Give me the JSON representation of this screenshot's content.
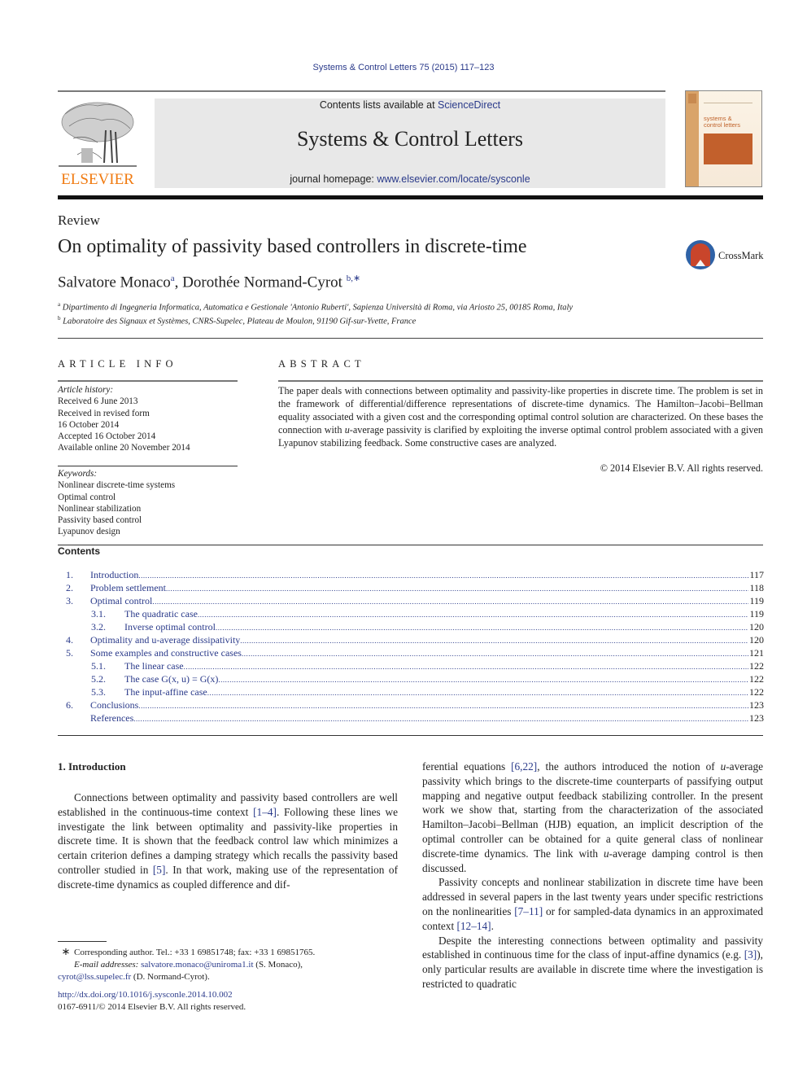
{
  "header": {
    "journal_ref": "Systems & Control Letters 75 (2015) 117–123",
    "contents_prefix": "Contents lists available at ",
    "contents_link": "ScienceDirect",
    "journal_title": "Systems & Control Letters",
    "homepage_prefix": "journal homepage: ",
    "homepage_link": "www.elsevier.com/locate/sysconle",
    "publisher_logo": "ELSEVIER",
    "cover_title_line1": "systems &",
    "cover_title_line2": "control letters"
  },
  "article": {
    "type": "Review",
    "title": "On optimality of passivity based controllers in discrete-time",
    "crossmark_label": "CrossMark",
    "authors": [
      {
        "name": "Salvatore Monaco",
        "sup": "a"
      },
      {
        "name": "Dorothée Normand-Cyrot",
        "sup": "b,∗"
      }
    ],
    "author_separator": ", ",
    "affiliations": [
      {
        "mark": "a",
        "text": "Dipartimento di Ingegneria Informatica, Automatica e Gestionale 'Antonio Ruberti', Sapienza Università di Roma, via Ariosto 25, 00185 Roma, Italy"
      },
      {
        "mark": "b",
        "text": "Laboratoire des Signaux et Systèmes, CNRS-Supelec, Plateau de Moulon, 91190 Gif-sur-Yvette, France"
      }
    ]
  },
  "article_info": {
    "heading": "ARTICLE INFO",
    "history_label": "Article history:",
    "history": [
      "Received 6 June 2013",
      "Received in revised form",
      "16 October 2014",
      "Accepted 16 October 2014",
      "Available online 20 November 2014"
    ],
    "keywords_label": "Keywords:",
    "keywords": [
      "Nonlinear discrete-time systems",
      "Optimal control",
      "Nonlinear stabilization",
      "Passivity based control",
      "Lyapunov design"
    ]
  },
  "abstract": {
    "heading": "ABSTRACT",
    "text_before_u": "The paper deals with connections between optimality and passivity-like properties in discrete time. The problem is set in the framework of differential/difference representations of discrete-time dynamics. The Hamilton–Jacobi–Bellman equality associated with a given cost and the corresponding optimal control solution are characterized. On these bases the connection with ",
    "u": "u",
    "text_after_u": "-average passivity is clarified by exploiting the inverse optimal control problem associated with a given Lyapunov stabilizing feedback. Some constructive cases are analyzed.",
    "copyright": "© 2014 Elsevier B.V. All rights reserved."
  },
  "contents": {
    "heading": "Contents",
    "entries": [
      {
        "num": "1.",
        "title": "Introduction",
        "page": "117",
        "sub": false
      },
      {
        "num": "2.",
        "title": "Problem settlement",
        "page": "118",
        "sub": false
      },
      {
        "num": "3.",
        "title": "Optimal control ",
        "page": "119",
        "sub": false
      },
      {
        "num": "3.1.",
        "title": "The quadratic case ",
        "page": "119",
        "sub": true
      },
      {
        "num": "3.2.",
        "title": "Inverse optimal control ",
        "page": "120",
        "sub": true
      },
      {
        "num": "4.",
        "title": "Optimality and u-average dissipativity ",
        "page": "120",
        "sub": false
      },
      {
        "num": "5.",
        "title": "Some examples and constructive cases",
        "page": "121",
        "sub": false
      },
      {
        "num": "5.1.",
        "title": "The linear case",
        "page": "122",
        "sub": true
      },
      {
        "num": "5.2.",
        "title": "The case G(x, u) = G(x) ",
        "page": "122",
        "sub": true
      },
      {
        "num": "5.3.",
        "title": "The input-affine case ",
        "page": "122",
        "sub": true
      },
      {
        "num": "6.",
        "title": "Conclusions",
        "page": "123",
        "sub": false
      },
      {
        "num": "",
        "title": "References",
        "page": "123",
        "sub": false
      }
    ]
  },
  "intro": {
    "heading": "1.  Introduction",
    "left_p1_a": "Connections between optimality and passivity based controllers are well established in the continuous-time context ",
    "left_p1_cite1": "[1–4]",
    "left_p1_b": ". Following these lines we investigate the link between optimality and passivity-like properties in discrete time. It is shown that the feedback control law which minimizes a certain criterion defines a damping strategy which recalls the passivity based controller studied in ",
    "left_p1_cite2": "[5]",
    "left_p1_c": ". In that work, making use of the representation of discrete-time dynamics as coupled difference and dif-",
    "right_p1_a": "ferential equations ",
    "right_p1_cite1": "[6,22]",
    "right_p1_b": ", the authors introduced the notion of ",
    "right_p1_u1": "u",
    "right_p1_c": "-average passivity which brings to the discrete-time counterparts of passifying output mapping and negative output feedback stabilizing controller. In the present work we show that, starting from the characterization of the associated Hamilton–Jacobi–Bellman (HJB) equation, an implicit description of the optimal controller can be obtained for a quite general class of nonlinear discrete-time dynamics. The link with ",
    "right_p1_u2": "u",
    "right_p1_d": "-average damping control is then discussed.",
    "right_p2_a": "Passivity concepts and nonlinear stabilization in discrete time have been addressed in several papers in the last twenty years under specific restrictions on the nonlinearities ",
    "right_p2_cite1": "[7–11]",
    "right_p2_b": " or for sampled-data dynamics in an approximated context ",
    "right_p2_cite2": "[12–14]",
    "right_p2_c": ".",
    "right_p3_a": "Despite the interesting connections between optimality and passivity established in continuous time for the class of input-affine dynamics (e.g. ",
    "right_p3_cite1": "[3]",
    "right_p3_b": "), only particular results are available in discrete time where the investigation is restricted to quadratic"
  },
  "footnotes": {
    "star": "∗",
    "corresponding": "Corresponding author. Tel.: +33 1 69851748; fax: +33 1 69851765.",
    "email_label": "E-mail addresses:",
    "email1": "salvatore.monaco@uniroma1.it",
    "email1_name": " (S. Monaco),",
    "email2": "cyrot@lss.supelec.fr",
    "email2_name": " (D. Normand-Cyrot).",
    "doi": "http://dx.doi.org/10.1016/j.sysconle.2014.10.002",
    "issn": "0167-6911/© 2014 Elsevier B.V. All rights reserved."
  },
  "colors": {
    "link": "#2a3a8a",
    "elsevier_orange": "#f07a10",
    "banner_bg": "#e8e8e8"
  }
}
